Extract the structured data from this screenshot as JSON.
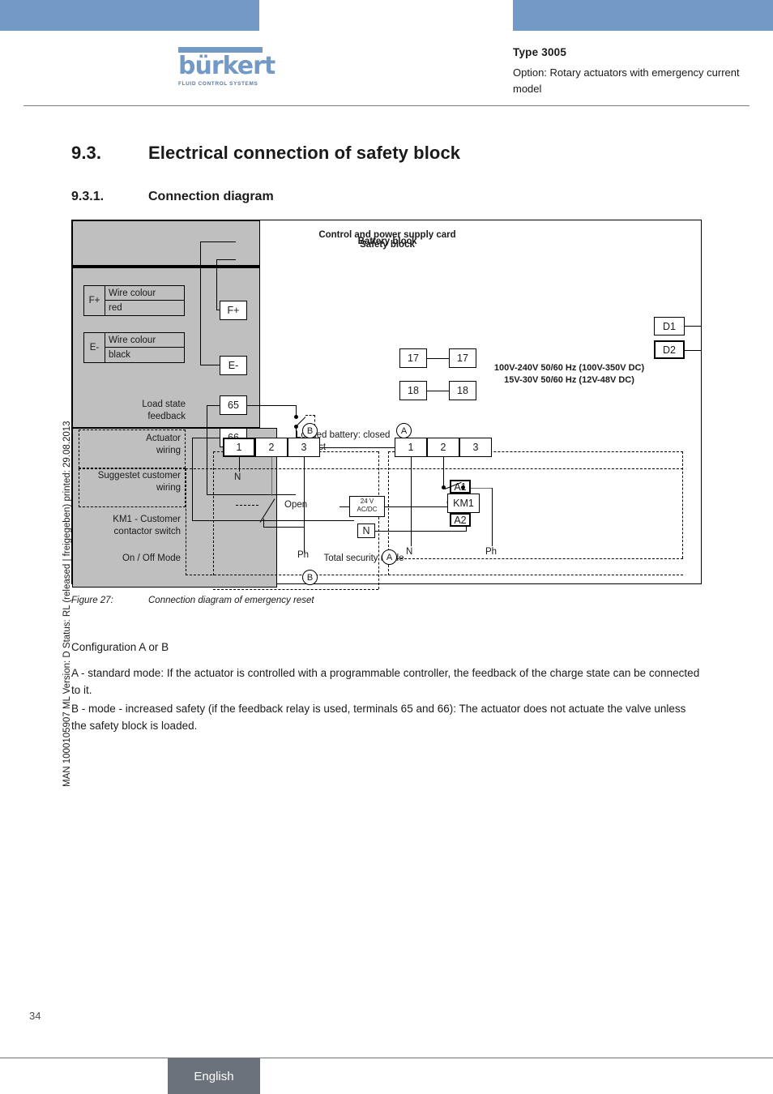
{
  "header": {
    "brand": "bürkert",
    "brand_tagline": "FLUID CONTROL SYSTEMS",
    "type_title": "Type 3005",
    "subtitle": "Option: Rotary actuators with emergency current model",
    "accent_color": "#7399c6"
  },
  "headings": {
    "h2_number": "9.3.",
    "h2_text": "Electrical connection of safety block",
    "h3_number": "9.3.1.",
    "h3_text": "Connection diagram"
  },
  "side_text": "MAN  1000105907  ML  Version: D  Status: RL (released | freigegeben)  printed: 29.08.2013",
  "figure": {
    "blocks": {
      "battery": "Battery block",
      "safety": "Safety block",
      "control": "Control and power supply card"
    },
    "voltage_line_1": "100V-240V 50/60 Hz (100V-350V DC)",
    "voltage_line_2": "15V-30V 50/60 Hz (12V-48V DC)",
    "wire_tables": [
      {
        "terminal": "F+",
        "header": "Wire colour",
        "colour": "red"
      },
      {
        "terminal": "E-",
        "header": "Wire colour",
        "colour": "black"
      }
    ],
    "terminals": {
      "f_plus": "F+",
      "e_minus": "E-",
      "t65": "65",
      "t66": "66",
      "t17_left": "17",
      "t17_right": "17",
      "t18_left": "18",
      "t18_right": "18",
      "d1": "D1",
      "d2": "D2",
      "a1": "A1",
      "a2": "A2",
      "km1": "KM1",
      "n_box": "N"
    },
    "connector_b": [
      "1",
      "2",
      "3"
    ],
    "connector_a": [
      "1",
      "2",
      "3"
    ],
    "marker_b": "B",
    "marker_a": "A",
    "left_labels": {
      "load_state": "Load state\nfeedback",
      "actuator_wiring": "Actuator\nwiring",
      "customer_wiring": "Suggestet customer\nwiring",
      "km1_label": "KM1 - Customer\ncontactor switch",
      "on_off": "On / Off Mode"
    },
    "notes": {
      "loaded_battery": "Loaded battery: closed\ncontact",
      "total_security": "Total security mode",
      "supply_24v_line1": "24 V",
      "supply_24v_line2": "AC/DC",
      "open_b": "Open",
      "open_a": "Open",
      "n_b": "N",
      "ph_b": "Ph",
      "n_a": "N",
      "ph_a": "Ph"
    }
  },
  "caption": {
    "label": "Figure 27:",
    "text": "Connection diagram of emergency reset"
  },
  "body": {
    "config_heading": "Configuration A or B",
    "para_a": "A - standard mode: If the actuator is controlled with a programmable controller, the feedback of the charge state can be connected to it.",
    "para_b": "B - mode - increased safety (if the feedback relay is used, terminals 65 and 66): The actuator does not actuate the valve unless the safety block is loaded."
  },
  "footer": {
    "page_number": "34",
    "language": "English"
  }
}
